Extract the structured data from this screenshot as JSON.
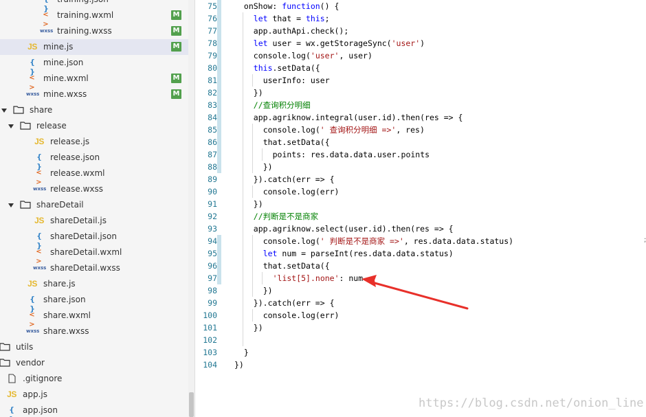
{
  "sidebar": {
    "items": [
      {
        "label": "training.json",
        "icon": "json",
        "indent": 1,
        "badge": ""
      },
      {
        "label": "training.wxml",
        "icon": "wxml",
        "indent": 1,
        "badge": "M"
      },
      {
        "label": "training.wxss",
        "icon": "wxss",
        "indent": 1,
        "badge": "M"
      },
      {
        "label": "mine.js",
        "icon": "js",
        "indent": 0,
        "badge": "M",
        "selected": true
      },
      {
        "label": "mine.json",
        "icon": "json",
        "indent": 0,
        "badge": ""
      },
      {
        "label": "mine.wxml",
        "icon": "wxml",
        "indent": 0,
        "badge": "M"
      },
      {
        "label": "mine.wxss",
        "icon": "wxss",
        "indent": 0,
        "badge": "M"
      },
      {
        "label": "share",
        "icon": "folder",
        "indent": -1,
        "arrow": "down"
      },
      {
        "label": "release",
        "icon": "folder",
        "indent": -0.5,
        "arrow": "down"
      },
      {
        "label": "release.js",
        "icon": "js",
        "indent": 0.5,
        "badge": ""
      },
      {
        "label": "release.json",
        "icon": "json",
        "indent": 0.5,
        "badge": ""
      },
      {
        "label": "release.wxml",
        "icon": "wxml",
        "indent": 0.5,
        "badge": ""
      },
      {
        "label": "release.wxss",
        "icon": "wxss",
        "indent": 0.5,
        "badge": ""
      },
      {
        "label": "shareDetail",
        "icon": "folder",
        "indent": -0.5,
        "arrow": "down"
      },
      {
        "label": "shareDetail.js",
        "icon": "js",
        "indent": 0.5,
        "badge": ""
      },
      {
        "label": "shareDetail.json",
        "icon": "json",
        "indent": 0.5,
        "badge": ""
      },
      {
        "label": "shareDetail.wxml",
        "icon": "wxml",
        "indent": 0.5,
        "badge": ""
      },
      {
        "label": "shareDetail.wxss",
        "icon": "wxss",
        "indent": 0.5,
        "badge": ""
      },
      {
        "label": "share.js",
        "icon": "js",
        "indent": 0,
        "badge": ""
      },
      {
        "label": "share.json",
        "icon": "json",
        "indent": 0,
        "badge": ""
      },
      {
        "label": "share.wxml",
        "icon": "wxml",
        "indent": 0,
        "badge": ""
      },
      {
        "label": "share.wxss",
        "icon": "wxss",
        "indent": 0,
        "badge": ""
      },
      {
        "label": "utils",
        "icon": "folder",
        "indent": -2,
        "arrow": "right"
      },
      {
        "label": "vendor",
        "icon": "folder",
        "indent": -2,
        "arrow": "right"
      },
      {
        "label": ".gitignore",
        "icon": "file",
        "indent": -1.5,
        "badge": ""
      },
      {
        "label": "app.js",
        "icon": "js",
        "indent": -1.5,
        "badge": ""
      },
      {
        "label": "app.json",
        "icon": "json",
        "indent": -1.5,
        "badge": ""
      }
    ],
    "icon_glyphs": {
      "js": "JS",
      "json": "{ }",
      "wxml": "< >",
      "wxss": "wxss",
      "folder": "folder-icon",
      "file": "file-icon"
    },
    "badge_color": "#52a04d"
  },
  "editor": {
    "lines": [
      {
        "n": "75",
        "indent": 1,
        "parts": [
          [
            "",
            "onShow: "
          ],
          [
            "kw",
            "function"
          ],
          [
            "",
            "() {"
          ]
        ]
      },
      {
        "n": "76",
        "indent": 2,
        "parts": [
          [
            "kw",
            "let"
          ],
          [
            "",
            " that = "
          ],
          [
            "kw",
            "this"
          ],
          [
            "",
            ";"
          ]
        ]
      },
      {
        "n": "77",
        "indent": 2,
        "parts": [
          [
            "",
            "app.authApi.check();"
          ]
        ]
      },
      {
        "n": "78",
        "indent": 2,
        "parts": [
          [
            "kw",
            "let"
          ],
          [
            "",
            " user = wx.getStorageSync("
          ],
          [
            "str",
            "'user'"
          ],
          [
            "",
            ")"
          ]
        ]
      },
      {
        "n": "79",
        "indent": 2,
        "parts": [
          [
            "",
            "console.log("
          ],
          [
            "str",
            "'user'"
          ],
          [
            "",
            ", user)"
          ]
        ]
      },
      {
        "n": "80",
        "indent": 2,
        "parts": [
          [
            "kw",
            "this"
          ],
          [
            "",
            ".setData({"
          ]
        ]
      },
      {
        "n": "81",
        "indent": 3,
        "parts": [
          [
            "",
            "userInfo: user"
          ]
        ]
      },
      {
        "n": "82",
        "indent": 2,
        "parts": [
          [
            "",
            "})"
          ]
        ]
      },
      {
        "n": "83",
        "indent": 2,
        "parts": [
          [
            "cm",
            "//查询积分明细"
          ]
        ]
      },
      {
        "n": "84",
        "indent": 2,
        "parts": [
          [
            "",
            "app.agriknow.integral(user.id).then(res => {"
          ]
        ]
      },
      {
        "n": "85",
        "indent": 3,
        "parts": [
          [
            "",
            "console.log("
          ],
          [
            "str",
            "' 查询积分明细 =>'"
          ],
          [
            "",
            ", res)"
          ]
        ]
      },
      {
        "n": "86",
        "indent": 3,
        "parts": [
          [
            "",
            "that.setData({"
          ]
        ]
      },
      {
        "n": "87",
        "indent": 4,
        "parts": [
          [
            "",
            "points: res.data.data.user.points"
          ]
        ]
      },
      {
        "n": "88",
        "indent": 3,
        "parts": [
          [
            "",
            "})"
          ]
        ]
      },
      {
        "n": "89",
        "indent": 2,
        "parts": [
          [
            "",
            "}).catch(err => {"
          ]
        ]
      },
      {
        "n": "90",
        "indent": 3,
        "parts": [
          [
            "",
            "console.log(err)"
          ]
        ]
      },
      {
        "n": "91",
        "indent": 2,
        "parts": [
          [
            "",
            "})"
          ]
        ]
      },
      {
        "n": "92",
        "indent": 2,
        "parts": [
          [
            "cm",
            "//判断是不是商家"
          ]
        ]
      },
      {
        "n": "93",
        "indent": 2,
        "parts": [
          [
            "",
            "app.agriknow.select(user.id).then(res => {"
          ]
        ]
      },
      {
        "n": "94",
        "indent": 3,
        "parts": [
          [
            "",
            "console.log("
          ],
          [
            "str",
            "' 判断是不是商家 =>'"
          ],
          [
            "",
            ", res.data.data.status)"
          ]
        ]
      },
      {
        "n": "95",
        "indent": 3,
        "parts": [
          [
            "kw",
            "let"
          ],
          [
            "",
            " num = parseInt(res.data.data.status)"
          ]
        ]
      },
      {
        "n": "96",
        "indent": 3,
        "parts": [
          [
            "",
            "that.setData({"
          ]
        ]
      },
      {
        "n": "97",
        "indent": 4,
        "parts": [
          [
            "str",
            "'list[5].none'"
          ],
          [
            "",
            ": num"
          ]
        ]
      },
      {
        "n": "98",
        "indent": 3,
        "parts": [
          [
            "",
            "})"
          ]
        ]
      },
      {
        "n": "99",
        "indent": 2,
        "parts": [
          [
            "",
            "}).catch(err => {"
          ]
        ]
      },
      {
        "n": "100",
        "indent": 3,
        "parts": [
          [
            "",
            "console.log(err)"
          ]
        ]
      },
      {
        "n": "101",
        "indent": 2,
        "parts": [
          [
            "",
            "})"
          ]
        ]
      },
      {
        "n": "102",
        "indent": 2,
        "parts": [
          [
            "",
            ""
          ]
        ]
      },
      {
        "n": "103",
        "indent": 1,
        "parts": [
          [
            "",
            "}"
          ]
        ]
      },
      {
        "n": "104",
        "indent": 0,
        "parts": [
          [
            "",
            "})"
          ]
        ]
      }
    ],
    "modified_line_markers": [
      "75",
      "76",
      "77",
      "78",
      "79",
      "80",
      "81",
      "82",
      "83",
      "84",
      "85",
      "86",
      "87",
      "88",
      "94",
      "95",
      "96",
      "97"
    ]
  },
  "annotation": {
    "color": "#e8302a"
  },
  "watermark": "https://blog.csdn.net/onion_line"
}
